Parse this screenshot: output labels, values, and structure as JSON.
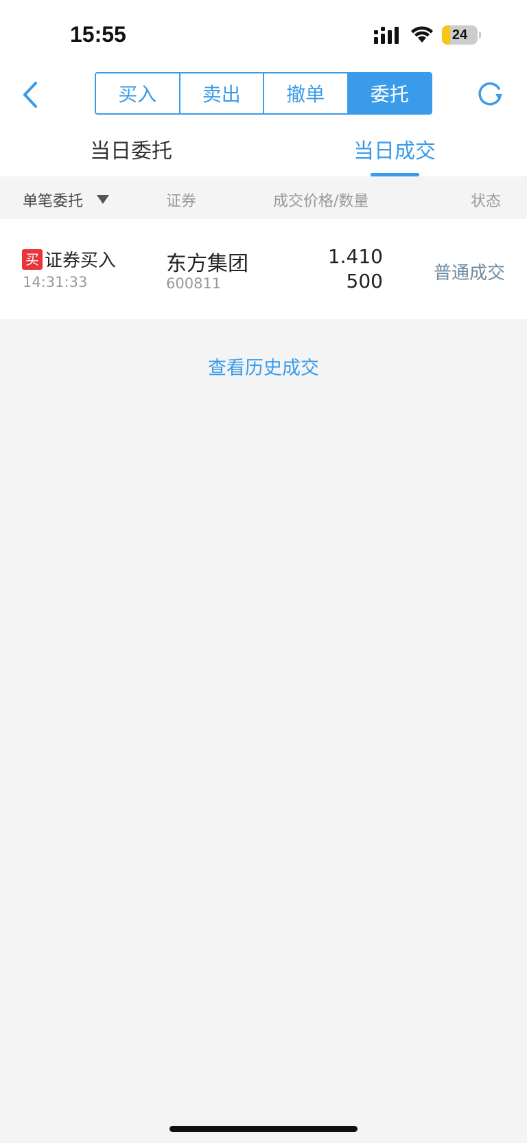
{
  "status_bar": {
    "time": "15:55",
    "battery_level": "24",
    "battery_fraction": 0.24,
    "icons": [
      "signal-icon",
      "wifi-icon",
      "battery-icon"
    ]
  },
  "nav": {
    "back_icon": "chevron-left-icon",
    "refresh_icon": "refresh-icon",
    "segments": [
      "买入",
      "卖出",
      "撤单",
      "委托"
    ],
    "active_segment": "委托"
  },
  "subtabs": {
    "items": [
      "当日委托",
      "当日成交"
    ],
    "active": "当日成交"
  },
  "columns": {
    "col1": "单笔委托",
    "col2": "证券",
    "col3": "成交价格/数量",
    "col4": "状态"
  },
  "rows": [
    {
      "badge": "买",
      "operation": "证券买入",
      "time": "14:31:33",
      "security_name": "东方集团",
      "security_code": "600811",
      "price": "1.410",
      "quantity": "500",
      "status": "普通成交"
    }
  ],
  "history_link": "查看历史成交",
  "colors": {
    "accent": "#3a9bea",
    "buy_red": "#e8343a",
    "status_text": "#6e8aa0",
    "battery_yellow": "#f5c518"
  }
}
